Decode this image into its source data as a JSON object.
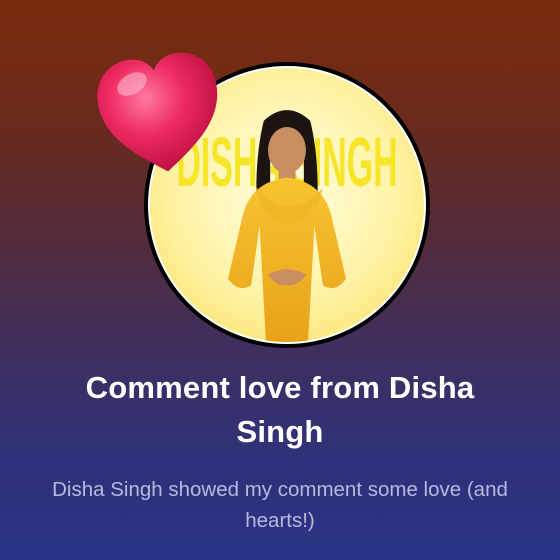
{
  "notification": {
    "avatar_name_art": "DISHA SINGH",
    "title": "Comment love from Disha Singh",
    "subtitle": "Disha Singh showed my comment some love (and hearts!)"
  },
  "icons": {
    "heart": "heart-icon",
    "avatar": "avatar-icon"
  },
  "colors": {
    "heart": "#e8154f",
    "title": "#ffffff",
    "subtitle": "#b9b9dc",
    "avatar_background": "#fff3a8",
    "avatar_name_art": "#f6e41a"
  }
}
